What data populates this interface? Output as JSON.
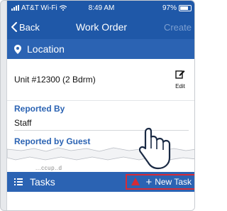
{
  "status_bar": {
    "carrier": "AT&T Wi-Fi",
    "time": "8:49 AM",
    "battery": "97%"
  },
  "nav": {
    "back_label": "Back",
    "title": "Work Order",
    "action_label": "Create"
  },
  "location_section": {
    "title": "Location",
    "unit_text": "Unit #12300 (2 Bdrm)",
    "edit_label": "Edit"
  },
  "reported_by": {
    "label": "Reported By",
    "value": "Staff"
  },
  "reported_by_guest": {
    "label": "Reported by Guest",
    "value": "...ccup..d"
  },
  "tasks_section": {
    "title": "Tasks",
    "new_task_label": "New Task"
  },
  "colors": {
    "nav_blue": "#1f58a8",
    "section_blue": "#2b63b3",
    "highlight_red": "#d62b36"
  },
  "icons": {
    "location": "location-pin-icon",
    "edit": "edit-pencil-icon",
    "tasks": "list-icon",
    "pointer": "pointing-hand-icon"
  }
}
